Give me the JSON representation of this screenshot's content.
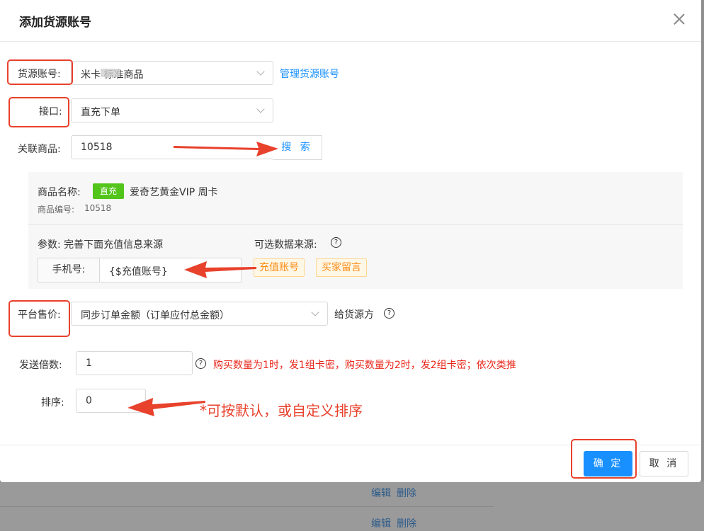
{
  "background": {
    "rows": [
      {
        "edit": "编辑",
        "delete": "删除"
      },
      {
        "edit": "编辑",
        "delete": "删除"
      }
    ]
  },
  "modal": {
    "title": "添加货源账号",
    "close_icon": "close-icon"
  },
  "form": {
    "source_account": {
      "label": "货源账号:",
      "value": "米卡 标准商品",
      "manage_link": "管理货源账号"
    },
    "interface": {
      "label": "接口:",
      "value": "直充下单"
    },
    "linked_product": {
      "label": "关联商品:",
      "value": "10518",
      "search_button": "搜 索"
    },
    "product_info": {
      "name_label": "商品名称:",
      "tag": "直充",
      "name": "爱奇艺黄金VIP 周卡",
      "code_label": "商品编号:",
      "code": "10518"
    },
    "params": {
      "label": "参数: 完善下面充值信息来源",
      "optional_label": "可选数据来源:",
      "field_label": "手机号:",
      "field_value": "{$充值账号}",
      "sources": [
        "充值账号",
        "买家留言"
      ]
    },
    "platform_price": {
      "label": "平台售价:",
      "value": "同步订单金额（订单应付总金额）",
      "suffix": "给货源方"
    },
    "send_multiplier": {
      "label": "发送倍数:",
      "value": "1",
      "hint": "购买数量为1时，发1组卡密，购买数量为2时，发2组卡密；依次类推"
    },
    "sort": {
      "label": "排序:",
      "value": "0",
      "annotation": "*可按默认，或自定义排序"
    }
  },
  "footer": {
    "ok_label": "确 定",
    "cancel_label": "取 消"
  },
  "colors": {
    "primary": "#1890ff",
    "success_tag": "#52c41a",
    "warning_tag": "#fa8c16",
    "annotation_red": "#e8412c"
  }
}
